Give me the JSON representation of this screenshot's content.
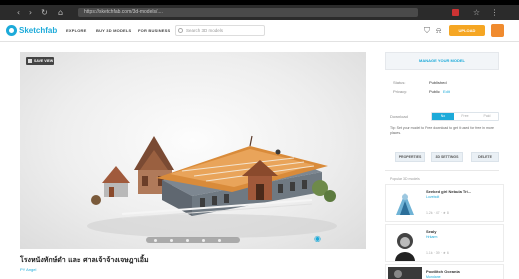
{
  "top_glyph": "ู",
  "browser": {
    "url": "https://sketchfab.com/3d-models/....",
    "back_icon": "‹",
    "forward_icon": "›",
    "reload_icon": "↻",
    "home_icon": "⌂",
    "menu_icons": [
      "☆",
      "⋮"
    ]
  },
  "header": {
    "logo": "Sketchfab",
    "nav": [
      "EXPLORE",
      "BUY 3D MODELS",
      "FOR BUSINESS"
    ],
    "search_placeholder": "Search 3D models",
    "upload_label": "UPLOAD",
    "brand_color": "#1caad9",
    "upload_color": "#f5a623"
  },
  "viewer": {
    "save_view_label": "SAVE VIEW"
  },
  "model": {
    "title": "โรงหนังทักษ์ดำ และ ศาลเจ้าจ้างเจษฎาเอิ้ม",
    "author": "PY Angel"
  },
  "panel": {
    "manage_label": "MANAGE YOUR MODEL",
    "status_key": "Status:",
    "status_value": "Published",
    "privacy_key": "Privacy:",
    "privacy_value": "Public",
    "privacy_edit": "Edit",
    "download_key": "Download",
    "toggle_options": [
      "No",
      "Free",
      "Paid"
    ],
    "tip": "Tip: Set your model to Free download to get it used for free in more places.",
    "buttons": [
      "PROPERTIES",
      "3D SETTINGS",
      "DELETE"
    ],
    "popular_title": "Popular 3D models",
    "cards": [
      {
        "name": "Seeked girl Nebula Tri...",
        "author": "Lovebolt",
        "stats": "1.2k  ·  47  ·  ★ 8"
      },
      {
        "name": "Sealy",
        "author": "Hrkarm",
        "stats": "1.1k  ·  39  ·  ★ 6"
      },
      {
        "name": "Pootlitch Oceania",
        "author": "Mundane",
        "stats": ""
      }
    ]
  }
}
